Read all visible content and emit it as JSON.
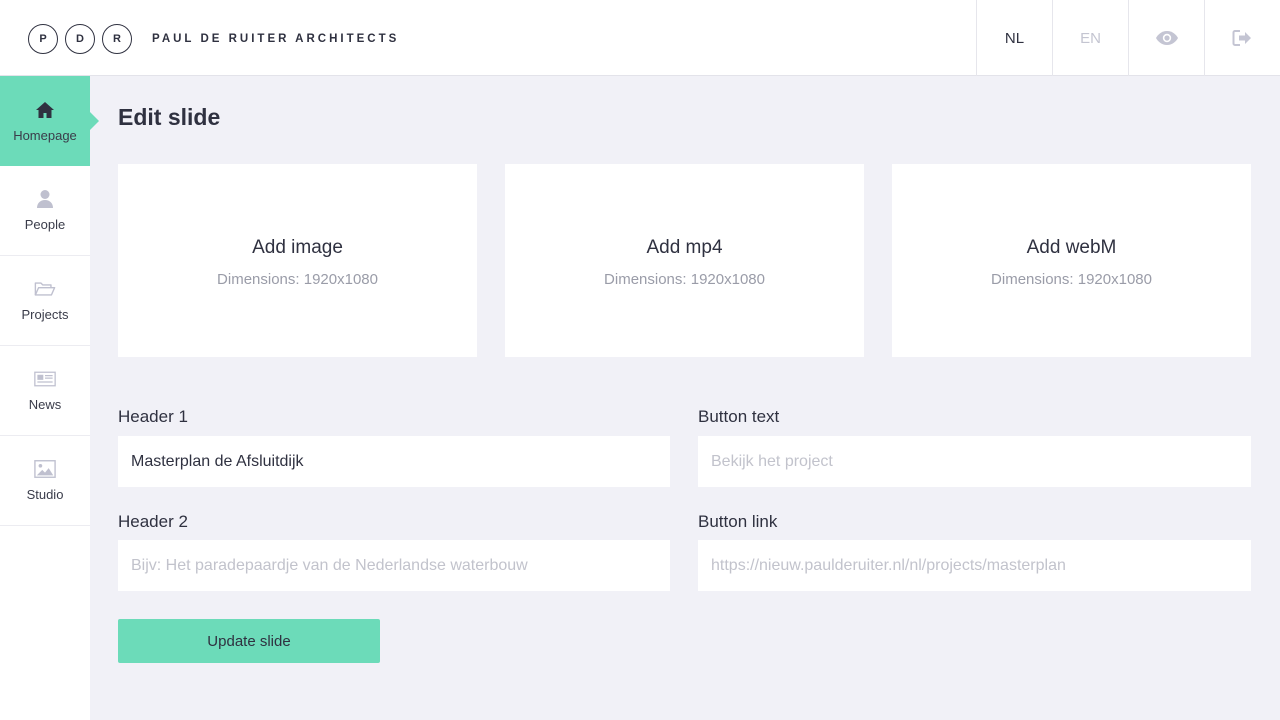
{
  "header": {
    "logo_letters": [
      "P",
      "D",
      "R"
    ],
    "brand": "PAUL DE RUITER ARCHITECTS",
    "lang_nl": "NL",
    "lang_en": "EN",
    "preview_icon": "eye-icon",
    "logout_icon": "sign-out-icon"
  },
  "sidebar": {
    "items": [
      {
        "label": "Homepage",
        "icon": "home-icon",
        "active": true
      },
      {
        "label": "People",
        "icon": "user-icon"
      },
      {
        "label": "Projects",
        "icon": "folder-icon"
      },
      {
        "label": "News",
        "icon": "newspaper-icon"
      },
      {
        "label": "Studio",
        "icon": "image-icon"
      }
    ]
  },
  "main": {
    "title": "Edit slide",
    "uploads": [
      {
        "title": "Add image",
        "sub": "Dimensions: 1920x1080"
      },
      {
        "title": "Add mp4",
        "sub": "Dimensions: 1920x1080"
      },
      {
        "title": "Add webM",
        "sub": "Dimensions: 1920x1080"
      }
    ],
    "form": {
      "header1": {
        "label": "Header 1",
        "value": "Masterplan de Afsluitdijk",
        "placeholder": ""
      },
      "button_text": {
        "label": "Button text",
        "value": "",
        "placeholder": "Bekijk het project"
      },
      "header2": {
        "label": "Header 2",
        "value": "",
        "placeholder": "Bijv: Het paradepaardje van de Nederlandse waterbouw"
      },
      "button_link": {
        "label": "Button link",
        "value": "",
        "placeholder": "https://nieuw.paulderuiter.nl/nl/projects/masterplan"
      }
    },
    "submit_label": "Update slide"
  },
  "colors": {
    "accent": "#6cdbb9",
    "text": "#2f3140",
    "muted": "#9a9ca8",
    "background": "#f1f1f7",
    "icon_gray": "#bfc0cf"
  }
}
